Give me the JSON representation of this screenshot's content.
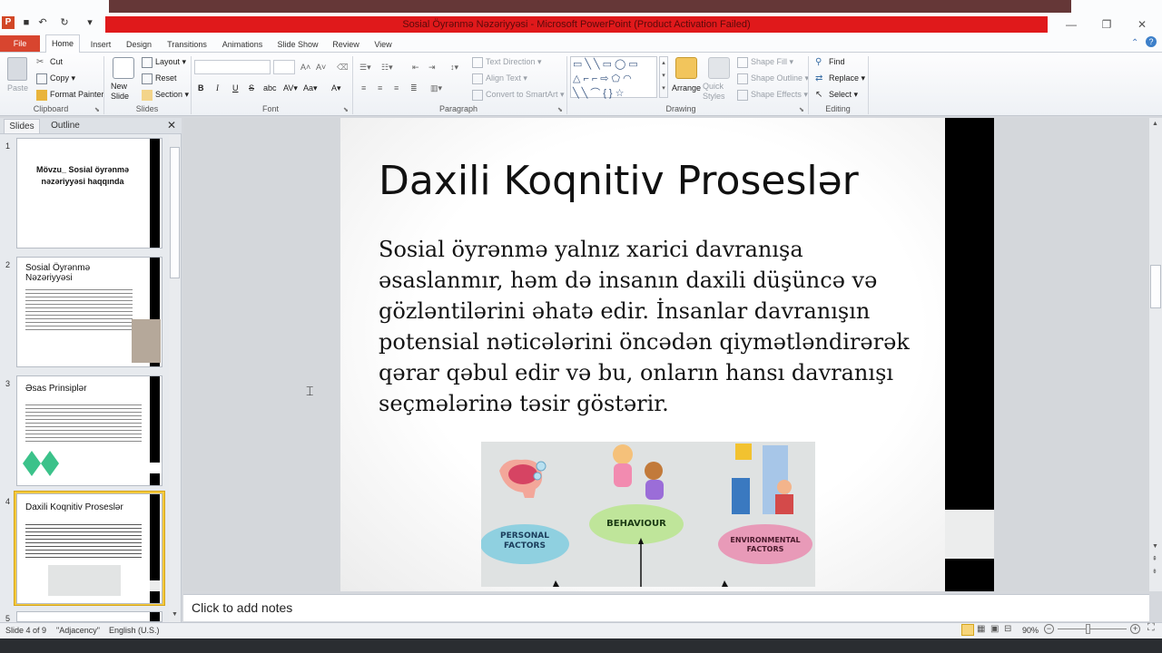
{
  "window": {
    "title": "Sosial Öyrənmə Nəzəriyyəsi - Microsoft PowerPoint (Product Activation Failed)"
  },
  "ribbon_tabs": [
    "File",
    "Home",
    "Insert",
    "Design",
    "Transitions",
    "Animations",
    "Slide Show",
    "Review",
    "View"
  ],
  "ribbon": {
    "clipboard": {
      "paste": "Paste",
      "cut": "Cut",
      "copy": "Copy",
      "format_painter": "Format Painter",
      "label": "Clipboard"
    },
    "slides": {
      "new_slide": "New Slide",
      "layout": "Layout",
      "reset": "Reset",
      "section": "Section",
      "label": "Slides"
    },
    "font": {
      "label": "Font",
      "bold": "B",
      "italic": "I",
      "underline": "U",
      "strike": "S",
      "shadow": "abc"
    },
    "paragraph": {
      "label": "Paragraph",
      "text_direction": "Text Direction",
      "align_text": "Align Text",
      "convert_smartart": "Convert to SmartArt"
    },
    "drawing": {
      "label": "Drawing",
      "arrange": "Arrange",
      "quick_styles": "Quick Styles",
      "shape_fill": "Shape Fill",
      "shape_outline": "Shape Outline",
      "shape_effects": "Shape Effects"
    },
    "editing": {
      "label": "Editing",
      "find": "Find",
      "replace": "Replace",
      "select": "Select"
    }
  },
  "left_panel": {
    "tab_slides": "Slides",
    "tab_outline": "Outline",
    "thumbnails": [
      {
        "num": "1",
        "title": "Mövzu_ Sosial öyrənmə nəzəriyyəsi haqqında"
      },
      {
        "num": "2",
        "title": "Sosial Öyrənmə Nəzəriyyəsi"
      },
      {
        "num": "3",
        "title": "Əsas Prinsiplər"
      },
      {
        "num": "4",
        "title": "Daxili Koqnitiv Proseslər"
      },
      {
        "num": "5",
        "title": ""
      }
    ]
  },
  "slide": {
    "title": "Daxili Koqnitiv Proseslər",
    "body": "Sosial öyrənmə yalnız xarici davranışa əsaslanmır, həm də insanın daxili düşüncə və gözləntilərini əhatə edir. İnsanlar davranışın potensial nəticələrini öncədən qiymətləndirərək qərar qəbul edir və bu, onların hansı davranışı seçmələrinə təsir göstərir.",
    "diagram": {
      "personal": "PERSONAL FACTORS",
      "behaviour": "BEHAVIOUR",
      "environmental": "ENVIRONMENTAL FACTORS"
    }
  },
  "notes": {
    "placeholder": "Click to add notes"
  },
  "status": {
    "slide_info": "Slide 4 of 9",
    "theme": "\"Adjacency\"",
    "language": "English (U.S.)",
    "zoom": "90%"
  },
  "colors": {
    "file_tab": "#d8452f",
    "title_bar": "#e0191b",
    "selected_thumb": "#f5c93c"
  }
}
